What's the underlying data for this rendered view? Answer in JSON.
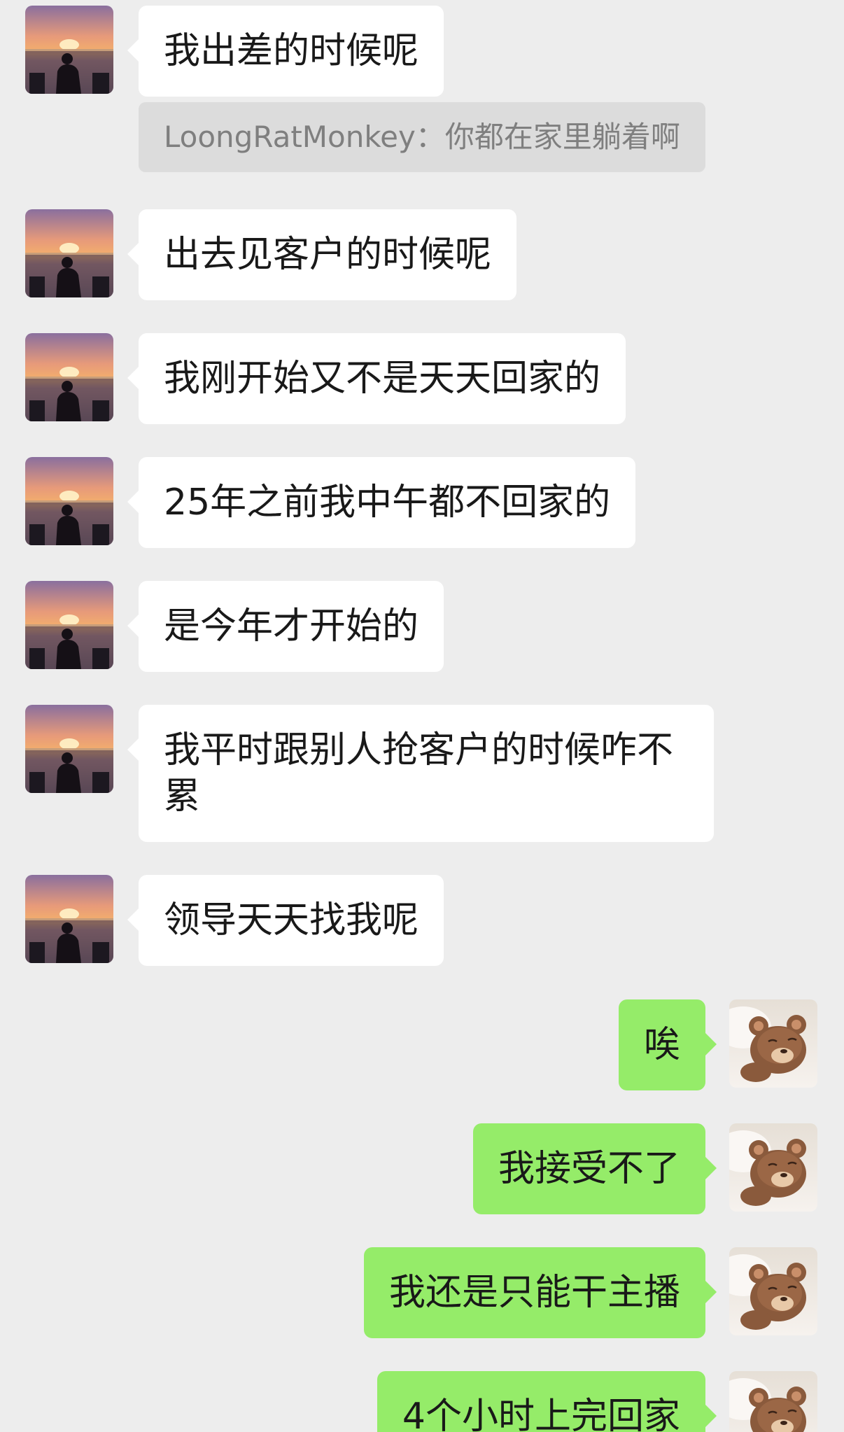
{
  "colors": {
    "background": "#ededed",
    "incoming_bubble": "#ffffff",
    "outgoing_bubble": "#95ec69",
    "quote_background": "#dcdcdc",
    "quote_text": "#7f7f7f"
  },
  "contact_avatar_icon": "sunset-silhouette-avatar-icon",
  "self_avatar_icon": "teddy-bear-avatar-icon",
  "messages": [
    {
      "sender": "contact",
      "text": "我出差的时候呢"
    },
    {
      "sender": "contact",
      "quote": "LoongRatMonkey：你都在家里躺着啊"
    },
    {
      "sender": "contact",
      "text": "出去见客户的时候呢"
    },
    {
      "sender": "contact",
      "text": "我刚开始又不是天天回家的"
    },
    {
      "sender": "contact",
      "text": "25年之前我中午都不回家的"
    },
    {
      "sender": "contact",
      "text": "是今年才开始的"
    },
    {
      "sender": "contact",
      "text": "我平时跟别人抢客户的时候咋不累"
    },
    {
      "sender": "contact",
      "text": "领导天天找我呢"
    },
    {
      "sender": "self",
      "text": "唉"
    },
    {
      "sender": "self",
      "text": "我接受不了"
    },
    {
      "sender": "self",
      "text": "我还是只能干主播"
    },
    {
      "sender": "self",
      "text": "4个小时上完回家"
    }
  ]
}
